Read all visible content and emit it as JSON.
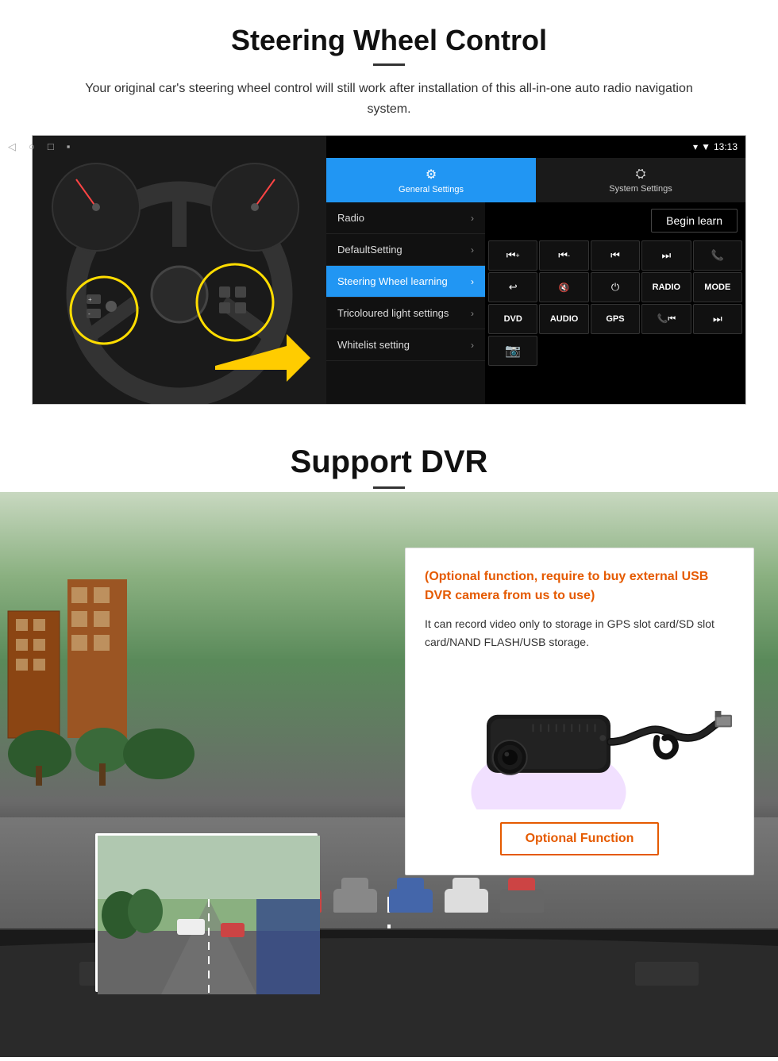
{
  "page": {
    "section1": {
      "title": "Steering Wheel Control",
      "subtitle": "Your original car's steering wheel control will still work after installation of this all-in-one auto radio navigation system.",
      "android_ui": {
        "status_bar": {
          "time": "13:13",
          "signal_icon": "▼",
          "wifi_icon": "▾"
        },
        "tabs": [
          {
            "id": "general",
            "label": "General Settings",
            "icon": "⚙",
            "active": true
          },
          {
            "id": "system",
            "label": "System Settings",
            "icon": "⛭",
            "active": false
          }
        ],
        "menu_items": [
          {
            "label": "Radio",
            "active": false
          },
          {
            "label": "DefaultSetting",
            "active": false
          },
          {
            "label": "Steering Wheel learning",
            "active": true
          },
          {
            "label": "Tricoloured light settings",
            "active": false
          },
          {
            "label": "Whitelist setting",
            "active": false
          }
        ],
        "begin_learn_label": "Begin learn",
        "control_buttons": [
          "⏮+",
          "⏮-",
          "⏮",
          "⏭",
          "📞",
          "↩",
          "🔇",
          "⏻",
          "RADIO",
          "MODE",
          "DVD",
          "AUDIO",
          "GPS",
          "📞⏮",
          "⏭"
        ]
      }
    },
    "section2": {
      "title": "Support DVR",
      "optional_text": "(Optional function, require to buy external USB DVR camera from us to use)",
      "description": "It can record video only to storage in GPS slot card/SD slot card/NAND FLASH/USB storage.",
      "optional_function_label": "Optional Function"
    }
  }
}
